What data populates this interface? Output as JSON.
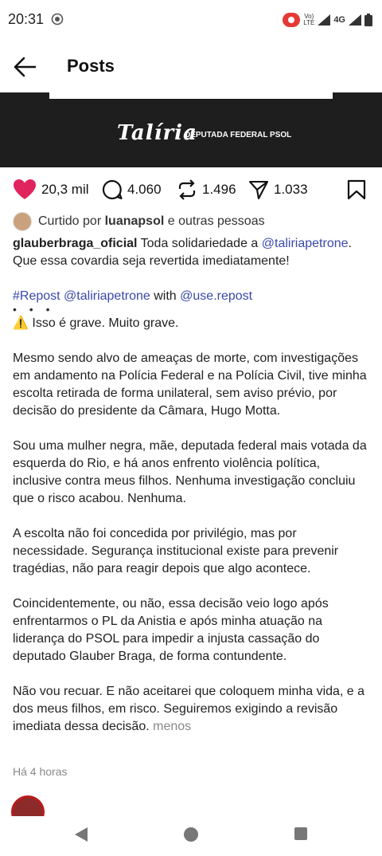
{
  "status_bar": {
    "time": "20:31",
    "icons": [
      "screen-record-icon",
      "volte-icon",
      "signal-icon",
      "4g-icon",
      "battery-icon"
    ],
    "volte_label": "Vo) LTE",
    "network_label": "4G"
  },
  "header": {
    "title": "Posts"
  },
  "banner": {
    "brand": "Talíria",
    "subtitle": "DEPUTADA FEDERAL PSOL"
  },
  "actions": {
    "likes": "20,3 mil",
    "comments": "4.060",
    "reposts": "1.496",
    "shares": "1.033",
    "like_color": "#e0245e"
  },
  "liked_by": {
    "prefix": "Curtido por",
    "user": "luanapsol",
    "suffix": "e outras pessoas"
  },
  "caption": {
    "author": "glauberbraga_oficial",
    "intro": "Toda solidariedade a",
    "mention": "@taliriapetrone",
    "intro_end": ".",
    "line2": "Que essa covardia seja revertida imediatamente!",
    "repost_tag": "#Repost",
    "repost_mention": "@taliriapetrone",
    "repost_with": "with",
    "repost_app": "@use.repost",
    "dots": "• • •",
    "p1": "⚠️ Isso é grave. Muito grave.",
    "p2": "Mesmo sendo alvo de ameaças de morte, com investigações em andamento na Polícia Federal e na Polícia Civil, tive minha escolta retirada de forma unilateral, sem aviso prévio, por decisão do presidente da Câmara, Hugo Motta.",
    "p3": "Sou uma mulher negra, mãe, deputada federal mais votada da esquerda do Rio, e há anos enfrento violência política, inclusive contra meus filhos. Nenhuma investigação concluiu que o risco acabou. Nenhuma.",
    "p4": "A escolta não foi concedida por privilégio, mas por necessidade. Segurança institucional existe para prevenir tragédias, não para reagir depois que algo acontece.",
    "p5": "Coincidentemente, ou não, essa decisão veio logo após enfrentarmos o PL da Anistia e após minha atuação na liderança do PSOL para impedir a injusta cassação do deputado Glauber Braga, de forma contundente.",
    "p6": "Não vou recuar.  E não aceitarei que coloquem minha vida, e a dos meus filhos, em risco. Seguiremos exigindo a revisão imediata dessa decisão.",
    "less": "menos"
  },
  "posted": "Há 4 horas"
}
